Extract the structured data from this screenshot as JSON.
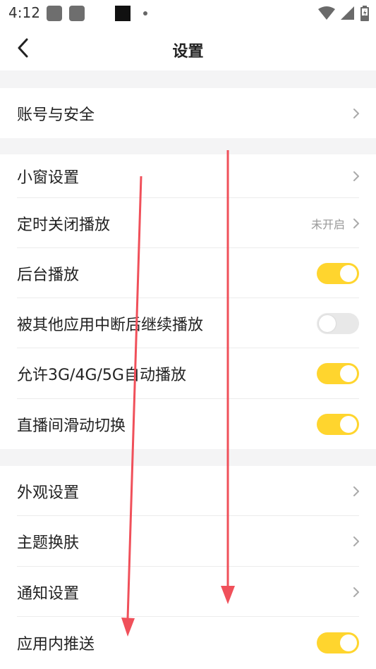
{
  "status_bar": {
    "time": "4:12"
  },
  "header": {
    "title": "设置"
  },
  "groups": [
    {
      "items": [
        {
          "label": "账号与安全",
          "control": "chevron"
        }
      ]
    },
    {
      "items": [
        {
          "label": "小窗设置",
          "control": "chevron"
        },
        {
          "label": "定时关闭播放",
          "control": "chevron",
          "value": "未开启"
        },
        {
          "label": "后台播放",
          "control": "toggle",
          "on": true
        },
        {
          "label": "被其他应用中断后继续播放",
          "control": "toggle",
          "on": false
        },
        {
          "label": "允许3G/4G/5G自动播放",
          "control": "toggle",
          "on": true
        },
        {
          "label": "直播间滑动切换",
          "control": "toggle",
          "on": true
        }
      ]
    },
    {
      "items": [
        {
          "label": "外观设置",
          "control": "chevron"
        },
        {
          "label": "主题换肤",
          "control": "chevron"
        },
        {
          "label": "通知设置",
          "control": "chevron"
        },
        {
          "label": "应用内推送",
          "control": "toggle",
          "on": true
        }
      ]
    }
  ],
  "colors": {
    "accent": "#ffd52e",
    "toggle_off": "#e8e8e8",
    "annotation_arrow": "#f0505a"
  },
  "icons": [
    "back-arrow-icon",
    "chevron-right-icon",
    "wifi-icon",
    "signal-icon",
    "battery-icon"
  ]
}
